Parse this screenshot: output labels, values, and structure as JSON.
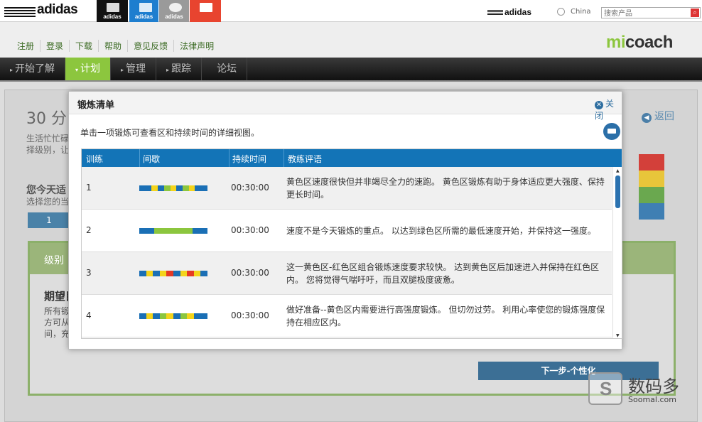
{
  "topbar": {
    "logo_text": "adidas",
    "brand_tabs": [
      {
        "label": "adidas",
        "bg": "#111111"
      },
      {
        "label": "adidas",
        "bg": "#1e7ecf"
      },
      {
        "label": "adidas",
        "bg": "#9a9a9a"
      },
      {
        "label": "",
        "bg": "#e8442f"
      }
    ],
    "right_logo": "adidas",
    "country": "China",
    "search_placeholder": "搜索产品"
  },
  "subnav": {
    "items": [
      "注册",
      "登录",
      "下载",
      "帮助",
      "意见反馈",
      "法律声明"
    ],
    "brand_mi": "mi",
    "brand_coach": "coach"
  },
  "mainnav": {
    "items": [
      {
        "label": "开始了解",
        "active": false
      },
      {
        "label": "计划",
        "active": true
      },
      {
        "label": "管理",
        "active": false
      },
      {
        "label": "跟踪",
        "active": false
      },
      {
        "label": "论坛",
        "active": false
      }
    ]
  },
  "background": {
    "title": "30 分",
    "text": "生活忙忙碌 择级别，让",
    "question": "您今天适",
    "question_sub": "选择您的当",
    "number_tab": "1",
    "panel_header": "级别",
    "panel_heading": "期望目",
    "panel_text": "所有锻 方可从 间，充",
    "back_label": "返回",
    "next_button": "下一步-个性化"
  },
  "modal": {
    "title": "锻炼清单",
    "close_label": "关闭",
    "description": "单击一项锻炼可查看区和持续时间的详细视图。",
    "columns": [
      "训练",
      "间歇",
      "持续时间",
      "教练评语"
    ],
    "rows": [
      {
        "number": "1",
        "duration": "00:30:00",
        "comment": "黄色区速度很快但并非竭尽全力的速跑。 黄色区锻炼有助于身体适应更大强度、保持更长时间。",
        "intervals": [
          [
            "blue",
            2
          ],
          [
            "yellow",
            1
          ],
          [
            "blue",
            1
          ],
          [
            "green",
            1
          ],
          [
            "yellow",
            1
          ],
          [
            "blue",
            1
          ],
          [
            "green",
            1
          ],
          [
            "yellow",
            1
          ],
          [
            "blue",
            2
          ]
        ]
      },
      {
        "number": "2",
        "duration": "00:30:00",
        "comment": "速度不是今天锻炼的重点。 以达到绿色区所需的最低速度开始，并保持这一强度。",
        "intervals": [
          [
            "blue",
            3
          ],
          [
            "green",
            8
          ],
          [
            "blue",
            3
          ]
        ]
      },
      {
        "number": "3",
        "duration": "00:30:00",
        "comment": "这一黄色区-红色区组合锻炼速度要求较快。 达到黄色区后加速进入并保持在红色区内。 您将觉得气喘吁吁，而且双腿极度疲惫。",
        "intervals": [
          [
            "blue",
            1
          ],
          [
            "yellow",
            1
          ],
          [
            "blue",
            1
          ],
          [
            "yellow",
            1
          ],
          [
            "red",
            1
          ],
          [
            "blue",
            1
          ],
          [
            "yellow",
            1
          ],
          [
            "red",
            1
          ],
          [
            "yellow",
            1
          ],
          [
            "blue",
            1
          ]
        ]
      },
      {
        "number": "4",
        "duration": "00:30:00",
        "comment": "做好准备--黄色区内需要进行高强度锻炼。 但切勿过劳。 利用心率使您的锻炼强度保持在相应区内。",
        "intervals": [
          [
            "blue",
            1
          ],
          [
            "yellow",
            1
          ],
          [
            "blue",
            1
          ],
          [
            "green",
            1
          ],
          [
            "yellow",
            1
          ],
          [
            "blue",
            1
          ],
          [
            "green",
            1
          ],
          [
            "yellow",
            1
          ],
          [
            "blue",
            2
          ]
        ]
      }
    ],
    "zone_colors": {
      "blue": "#1a6fb5",
      "green": "#8cc63e",
      "yellow": "#f4d41b",
      "red": "#e53a24"
    }
  },
  "watermark": {
    "cn": "数码多",
    "en": "Soomal.com"
  }
}
